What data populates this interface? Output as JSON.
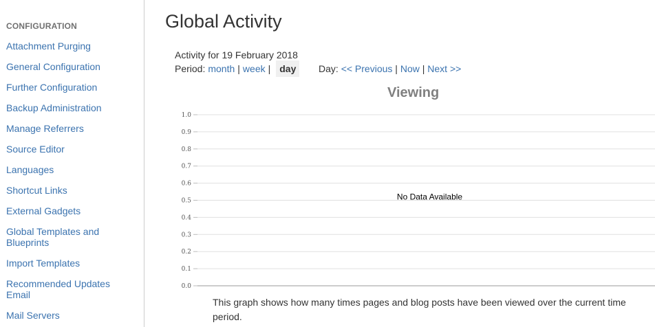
{
  "sidebar": {
    "heading": "CONFIGURATION",
    "items": [
      {
        "label": "Attachment Purging"
      },
      {
        "label": "General Configuration"
      },
      {
        "label": "Further Configuration"
      },
      {
        "label": "Backup Administration"
      },
      {
        "label": "Manage Referrers"
      },
      {
        "label": "Source Editor"
      },
      {
        "label": "Languages"
      },
      {
        "label": "Shortcut Links"
      },
      {
        "label": "External Gadgets"
      },
      {
        "label": "Global Templates and Blueprints"
      },
      {
        "label": "Import Templates"
      },
      {
        "label": "Recommended Updates Email"
      },
      {
        "label": "Mail Servers"
      }
    ]
  },
  "main": {
    "title": "Global Activity",
    "activity_date": "Activity for 19 February 2018",
    "period": {
      "label": "Period:",
      "month": "month",
      "week": "week",
      "day": "day",
      "separator": "|"
    },
    "day_nav": {
      "label": "Day:",
      "previous": "<< Previous",
      "now": "Now",
      "next": "Next >>",
      "separator": "|"
    },
    "description": "This graph shows how many times pages and blog posts have been viewed over the current time period."
  },
  "chart_data": {
    "type": "line",
    "title": "Viewing",
    "ylim": [
      0,
      1
    ],
    "y_ticks": [
      "1.0",
      "0.9",
      "0.8",
      "0.7",
      "0.6",
      "0.5",
      "0.4",
      "0.3",
      "0.2",
      "0.1",
      "0.0"
    ],
    "series": [],
    "message": "No Data Available",
    "grid": true
  }
}
